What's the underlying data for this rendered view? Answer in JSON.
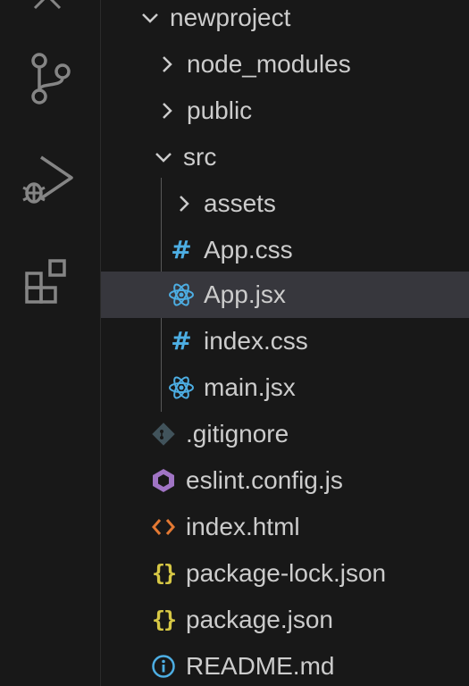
{
  "activity_bar": {
    "items": [
      {
        "name": "source-control",
        "icon": "source-control-icon"
      },
      {
        "name": "run-and-debug",
        "icon": "run-debug-icon"
      },
      {
        "name": "extensions",
        "icon": "extensions-icon"
      }
    ]
  },
  "explorer": {
    "tree": [
      {
        "label": "newproject",
        "type": "folder",
        "expanded": true,
        "depth": 0
      },
      {
        "label": "node_modules",
        "type": "folder",
        "expanded": false,
        "depth": 1
      },
      {
        "label": "public",
        "type": "folder",
        "expanded": false,
        "depth": 1
      },
      {
        "label": "src",
        "type": "folder",
        "expanded": true,
        "depth": 1
      },
      {
        "label": "assets",
        "type": "folder",
        "expanded": false,
        "depth": 2
      },
      {
        "label": "App.css",
        "type": "file",
        "icon": "css-hash-icon",
        "depth": 2
      },
      {
        "label": "App.jsx",
        "type": "file",
        "icon": "react-icon",
        "depth": 2,
        "selected": true
      },
      {
        "label": "index.css",
        "type": "file",
        "icon": "css-hash-icon",
        "depth": 2
      },
      {
        "label": "main.jsx",
        "type": "file",
        "icon": "react-icon",
        "depth": 2
      },
      {
        "label": ".gitignore",
        "type": "file",
        "icon": "git-icon",
        "depth": 1
      },
      {
        "label": "eslint.config.js",
        "type": "file",
        "icon": "eslint-icon",
        "depth": 1
      },
      {
        "label": "index.html",
        "type": "file",
        "icon": "html-icon",
        "depth": 1
      },
      {
        "label": "package-lock.json",
        "type": "file",
        "icon": "json-icon",
        "depth": 1
      },
      {
        "label": "package.json",
        "type": "file",
        "icon": "json-icon",
        "depth": 1
      },
      {
        "label": "README.md",
        "type": "file",
        "icon": "info-icon",
        "depth": 1
      }
    ]
  },
  "colors": {
    "background": "#181818",
    "selected_row": "#37373d",
    "text": "#cccccc",
    "icon_gray": "#858585",
    "css_icon": "#4daee3",
    "react_icon": "#4daee3",
    "json_icon": "#d7c845",
    "html_icon": "#e37933",
    "eslint_icon": "#a074c4",
    "git_icon": "#41535b",
    "info_icon": "#4daee3"
  }
}
